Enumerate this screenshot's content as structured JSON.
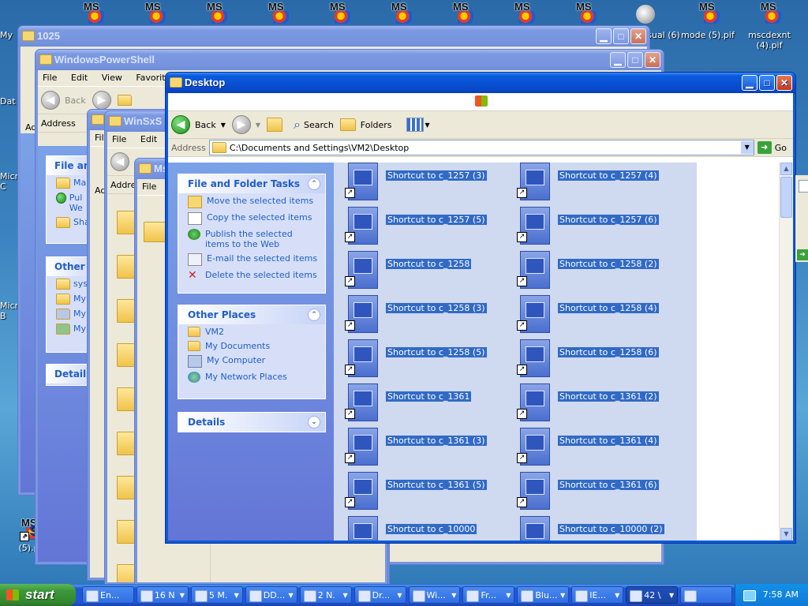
{
  "desktop": {
    "icons": [
      {
        "label": "My",
        "shortcut": false
      },
      {
        "label": "Dat",
        "shortcut": false
      },
      {
        "label": "Micr",
        "shortcut": false
      },
      {
        "label": "Micro",
        "shortcut": false
      },
      {
        "label": "(5).pif",
        "shortcut": true
      },
      {
        "label": "t Visual (6)",
        "shortcut": true
      },
      {
        "label": "mode (5).pif",
        "shortcut": true
      },
      {
        "label": "mscdexnt (4).pif",
        "shortcut": true
      }
    ],
    "top_row_labels": [
      "MS",
      "MS",
      "MS",
      "MS",
      "MS",
      "MS",
      "MS",
      "MS",
      "MS",
      "MS",
      "MS"
    ],
    "side_label_top": "My",
    "side_label_dat": "Dat",
    "side_label_micr": "Micr\nC",
    "side_label_micro": "Micro\nB",
    "bottom_label": "(5).pif"
  },
  "windows": {
    "w1025": {
      "title": "1025",
      "min": "▁",
      "max": "□",
      "close": "✕"
    },
    "powershell": {
      "title": "WindowsPowerShell",
      "menu": [
        "File",
        "Edit",
        "View",
        "Favorites"
      ],
      "back_label": "Back",
      "address_label": "Address",
      "panel1_title": "File an",
      "panel1_items": [
        "Ma",
        "Pul We",
        "Sha"
      ],
      "panel2_title": "Other",
      "panel2_items": [
        "sys",
        "My",
        "My",
        "My"
      ],
      "panel3_title": "Details"
    },
    "winsxs": {
      "title": "WinSxS",
      "menu": [
        "File",
        "Edit"
      ],
      "address_label": "Addre"
    },
    "ms": {
      "title": "Ms",
      "menu": [
        "File"
      ]
    },
    "left_stub": {
      "title": "",
      "address_label": "Ad"
    }
  },
  "desktop_window": {
    "title": "Desktop",
    "toolbar": {
      "back": "Back",
      "search": "Search",
      "folders": "Folders"
    },
    "address_label": "Address",
    "address_value": "C:\\Documents and Settings\\VM2\\Desktop",
    "go_label": "Go",
    "file_tasks": {
      "title": "File and Folder Tasks",
      "items": [
        "Move the selected items",
        "Copy the selected items",
        "Publish the selected items to the Web",
        "E-mail the selected items",
        "Delete the selected items"
      ]
    },
    "other_places": {
      "title": "Other Places",
      "items": [
        "VM2",
        "My Documents",
        "My Computer",
        "My Network Places"
      ]
    },
    "details": {
      "title": "Details"
    },
    "files": [
      [
        "Shortcut to c_1257 (3)",
        "Shortcut to c_1257 (4)"
      ],
      [
        "Shortcut to c_1257 (5)",
        "Shortcut to c_1257 (6)"
      ],
      [
        "Shortcut to c_1258",
        "Shortcut to c_1258 (2)"
      ],
      [
        "Shortcut to c_1258 (3)",
        "Shortcut to c_1258 (4)"
      ],
      [
        "Shortcut to c_1258 (5)",
        "Shortcut to c_1258 (6)"
      ],
      [
        "Shortcut to c_1361",
        "Shortcut to c_1361 (2)"
      ],
      [
        "Shortcut to c_1361 (3)",
        "Shortcut to c_1361 (4)"
      ],
      [
        "Shortcut to c_1361 (5)",
        "Shortcut to c_1361 (6)"
      ],
      [
        "Shortcut to c_10000",
        "Shortcut to c_10000 (2)"
      ]
    ]
  },
  "taskbar": {
    "start": "start",
    "tasks": [
      {
        "label": "En...",
        "active": false
      },
      {
        "label": "16 N",
        "active": false
      },
      {
        "label": "5 M.",
        "active": false
      },
      {
        "label": "DD...",
        "active": false
      },
      {
        "label": "2 N.",
        "active": false
      },
      {
        "label": "Dr...",
        "active": false
      },
      {
        "label": "Wi...",
        "active": false
      },
      {
        "label": "Fr...",
        "active": false
      },
      {
        "label": "Blu...",
        "active": false
      },
      {
        "label": "IE...",
        "active": false
      },
      {
        "label": "42 \\",
        "active": true
      },
      {
        "label": "",
        "active": false
      }
    ],
    "clock": "7:58 AM"
  },
  "colors": {
    "xp_blue": "#0b5bd9",
    "selection": "#316ac5",
    "task_link": "#215dc6"
  }
}
